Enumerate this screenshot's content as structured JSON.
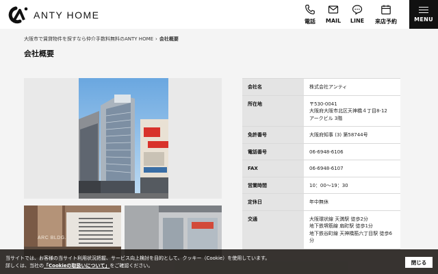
{
  "header": {
    "logo_text": "ANTY HOME",
    "nav": [
      {
        "label": "電話",
        "icon": "phone-icon"
      },
      {
        "label": "MAIL",
        "icon": "mail-icon"
      },
      {
        "label": "LINE",
        "icon": "line-icon"
      },
      {
        "label": "来店予約",
        "icon": "calendar-icon"
      }
    ],
    "menu_label": "MENU"
  },
  "breadcrumb": {
    "home": "大阪市で賃貸物件を探すなら仲介手数料無料のANTY HOME",
    "separator": "›",
    "current": "会社概要"
  },
  "page_title": "会社概要",
  "company": {
    "rows": [
      {
        "key": "会社名",
        "value": "株式会社アンティ"
      },
      {
        "key": "所在地",
        "value_lines": [
          "〒530-0041",
          "大阪府大阪市北区天神橋４丁目8-12",
          "アークビル 3階"
        ]
      },
      {
        "key": "免許番号",
        "value": "大阪府知事 (3) 第58744号"
      },
      {
        "key": "電話番号",
        "value": "06-6948-6106"
      },
      {
        "key": "FAX",
        "value": "06-6948-6107"
      },
      {
        "key": "営業時間",
        "value": "10：00〜19：30"
      },
      {
        "key": "定休日",
        "value": "年中無休"
      },
      {
        "key": "交通",
        "value_lines": [
          "大阪環状線 天満駅 徒歩2分",
          "地下鉄堺筋線 扇町駅 徒歩1分",
          "地下鉄谷町線 天神橋筋六丁目駅 徒歩6分"
        ]
      }
    ]
  },
  "photos": {
    "thumb1_sign": "ARC BLDG."
  },
  "cookie": {
    "line1": "当サイトでは、お客様の当サイト利用状況把握、サービス向上検討を目的として、クッキー（Cookie）を使用しています。",
    "line2_pre": "詳しくは、当社の",
    "line2_link": "「Cookieの取扱いについて」",
    "line2_post": "をご確認ください。",
    "close_label": "閉じる"
  },
  "colors": {
    "header_bg": "#ffffff",
    "menu_bg": "#111111",
    "table_key_bg": "#e4e4e4",
    "cookie_bg": "#282420"
  }
}
